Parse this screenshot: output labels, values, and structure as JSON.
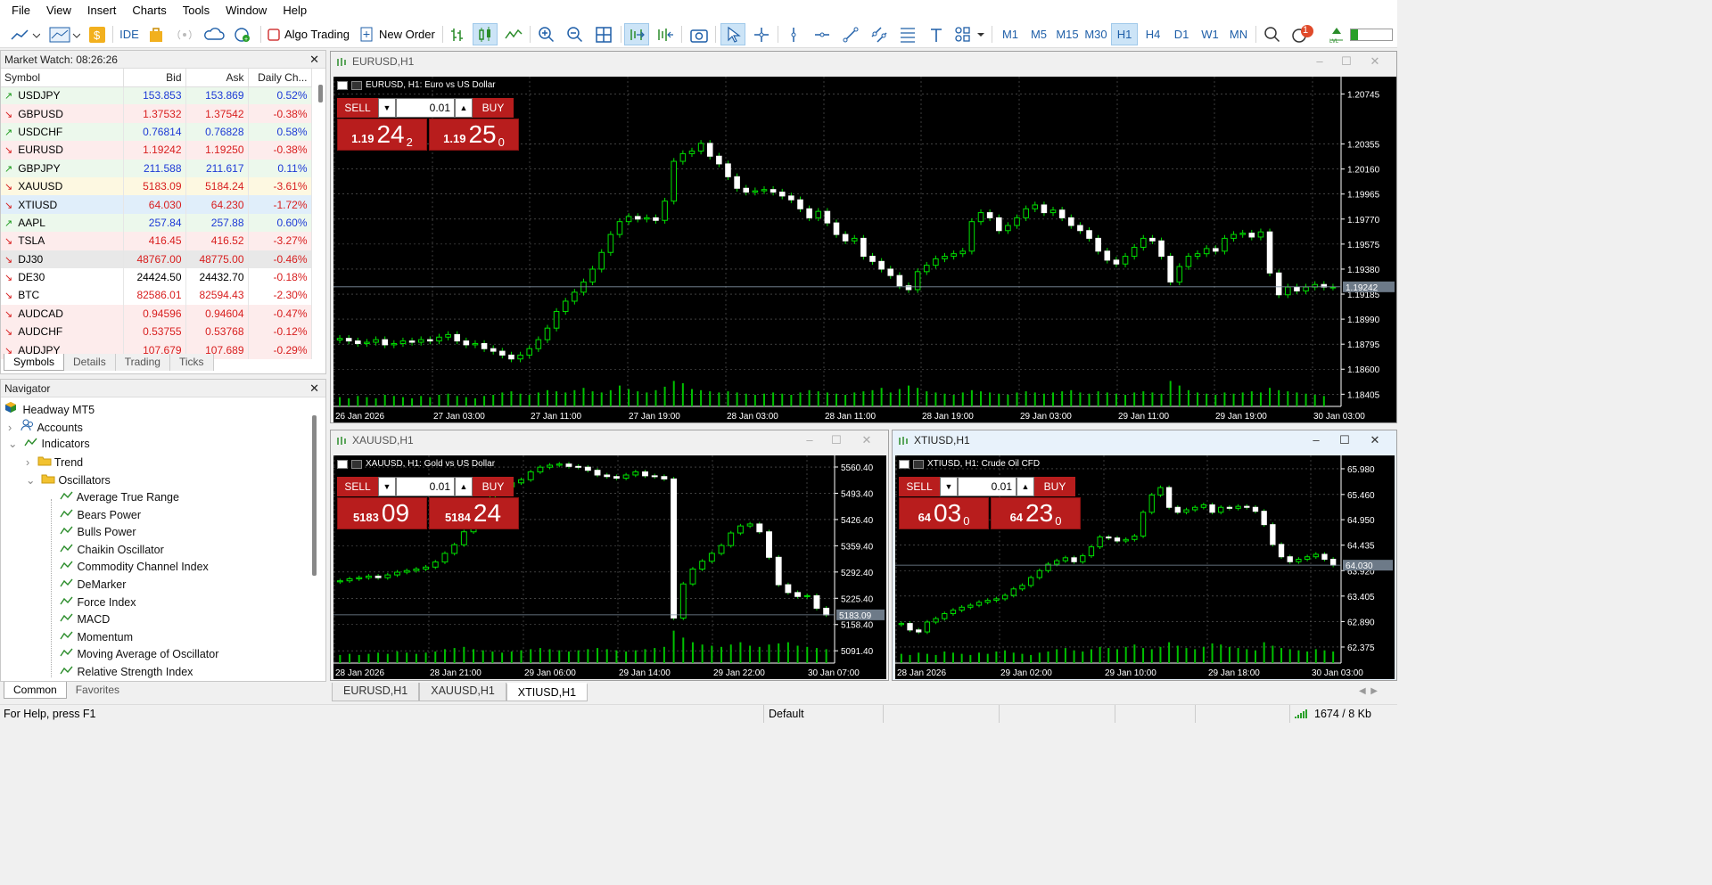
{
  "menu": [
    "File",
    "View",
    "Insert",
    "Charts",
    "Tools",
    "Window",
    "Help"
  ],
  "toolbar": {
    "ide_label": "IDE",
    "algo_label": "Algo Trading",
    "new_order_label": "New Order",
    "timeframes": [
      "M1",
      "M5",
      "M15",
      "M30",
      "H1",
      "H4",
      "D1",
      "W1",
      "MN"
    ],
    "active_timeframe": "H1",
    "notification_count": "1"
  },
  "market_watch": {
    "title": "Market Watch: 08:26:26",
    "headers": [
      "Symbol",
      "Bid",
      "Ask",
      "Daily Ch..."
    ],
    "rows": [
      {
        "symbol": "USDJPY",
        "bid": "153.853",
        "ask": "153.869",
        "change": "0.52%",
        "dir": "up"
      },
      {
        "symbol": "GBPUSD",
        "bid": "1.37532",
        "ask": "1.37542",
        "change": "-0.38%",
        "dir": "down"
      },
      {
        "symbol": "USDCHF",
        "bid": "0.76814",
        "ask": "0.76828",
        "change": "0.58%",
        "dir": "up"
      },
      {
        "symbol": "EURUSD",
        "bid": "1.19242",
        "ask": "1.19250",
        "change": "-0.38%",
        "dir": "down"
      },
      {
        "symbol": "GBPJPY",
        "bid": "211.588",
        "ask": "211.617",
        "change": "0.11%",
        "dir": "up"
      },
      {
        "symbol": "XAUUSD",
        "bid": "5183.09",
        "ask": "5184.24",
        "change": "-3.61%",
        "dir": "down"
      },
      {
        "symbol": "XTIUSD",
        "bid": "64.030",
        "ask": "64.230",
        "change": "-1.72%",
        "dir": "down"
      },
      {
        "symbol": "AAPL",
        "bid": "257.84",
        "ask": "257.88",
        "change": "0.60%",
        "dir": "up"
      },
      {
        "symbol": "TSLA",
        "bid": "416.45",
        "ask": "416.52",
        "change": "-3.27%",
        "dir": "down"
      },
      {
        "symbol": "DJ30",
        "bid": "48767.00",
        "ask": "48775.00",
        "change": "-0.46%",
        "dir": "down"
      },
      {
        "symbol": "DE30",
        "bid": "24424.50",
        "ask": "24432.70",
        "change": "-0.18%",
        "dir": "down"
      },
      {
        "symbol": "BTC",
        "bid": "82586.01",
        "ask": "82594.43",
        "change": "-2.30%",
        "dir": "down"
      },
      {
        "symbol": "AUDCAD",
        "bid": "0.94596",
        "ask": "0.94604",
        "change": "-0.47%",
        "dir": "down"
      },
      {
        "symbol": "AUDCHF",
        "bid": "0.53755",
        "ask": "0.53768",
        "change": "-0.12%",
        "dir": "down"
      },
      {
        "symbol": "AUDJPY",
        "bid": "107.679",
        "ask": "107.689",
        "change": "-0.29%",
        "dir": "down"
      }
    ],
    "tabs": [
      "Symbols",
      "Details",
      "Trading",
      "Ticks"
    ],
    "active_tab": "Symbols"
  },
  "navigator": {
    "title": "Navigator",
    "root": "Headway MT5",
    "accounts": "Accounts",
    "indicators": "Indicators",
    "trend": "Trend",
    "oscillators": "Oscillators",
    "items": [
      "Average True Range",
      "Bears Power",
      "Bulls Power",
      "Chaikin Oscillator",
      "Commodity Channel Index",
      "DeMarker",
      "Force Index",
      "MACD",
      "Momentum",
      "Moving Average of Oscillator",
      "Relative Strength Index"
    ],
    "tabs": [
      "Common",
      "Favorites"
    ],
    "active_tab": "Common"
  },
  "charts": [
    {
      "window_title": "EURUSD,H1",
      "title": "EURUSD, H1:  Euro vs US Dollar",
      "sell_label": "SELL",
      "buy_label": "BUY",
      "lot": "0.01",
      "sell_small": "1.19",
      "sell_big": "24",
      "sell_sup": "2",
      "buy_small": "1.19",
      "buy_big": "25",
      "buy_sup": "0",
      "price_label": "1.19242",
      "y_ticks": [
        "1.20745",
        "1.20355",
        "1.20160",
        "1.19965",
        "1.19770",
        "1.19575",
        "1.19380",
        "1.19185",
        "1.18990",
        "1.18795",
        "1.18600",
        "1.18405"
      ],
      "x_ticks": [
        "26 Jan 2026",
        "27 Jan 03:00",
        "27 Jan 11:00",
        "27 Jan 19:00",
        "28 Jan 03:00",
        "28 Jan 11:00",
        "28 Jan 19:00",
        "29 Jan 03:00",
        "29 Jan 11:00",
        "29 Jan 19:00",
        "30 Jan 03:00"
      ],
      "chart_data": {
        "type": "candlestick",
        "y_range": [
          1.1831,
          1.2088
        ],
        "closes": [
          1.1884,
          1.1882,
          1.188,
          1.1881,
          1.1883,
          1.1879,
          1.188,
          1.1882,
          1.1881,
          1.1883,
          1.1882,
          1.1885,
          1.1887,
          1.1882,
          1.1879,
          1.188,
          1.1876,
          1.1874,
          1.1871,
          1.1868,
          1.1871,
          1.1876,
          1.1883,
          1.1892,
          1.1905,
          1.1913,
          1.192,
          1.1928,
          1.1938,
          1.1951,
          1.1965,
          1.1975,
          1.1979,
          1.1977,
          1.1978,
          1.1976,
          1.1991,
          1.2022,
          1.2028,
          1.203,
          1.2036,
          1.2026,
          1.202,
          1.201,
          1.2001,
          1.1998,
          1.1999,
          1.2,
          1.1998,
          1.1995,
          1.1992,
          1.1985,
          1.1978,
          1.1983,
          1.1974,
          1.1965,
          1.196,
          1.1962,
          1.1948,
          1.1944,
          1.1938,
          1.1933,
          1.1925,
          1.1922,
          1.1936,
          1.1941,
          1.1946,
          1.1948,
          1.195,
          1.1952,
          1.1975,
          1.1982,
          1.1978,
          1.1968,
          1.1972,
          1.1978,
          1.1985,
          1.1988,
          1.1982,
          1.1984,
          1.1978,
          1.1972,
          1.1968,
          1.1962,
          1.1952,
          1.1945,
          1.1942,
          1.1948,
          1.1955,
          1.1962,
          1.196,
          1.1948,
          1.1928,
          1.194,
          1.1948,
          1.195,
          1.1954,
          1.1952,
          1.1962,
          1.1965,
          1.1966,
          1.1963,
          1.1967,
          1.1935,
          1.1918,
          1.1924,
          1.1921,
          1.1924,
          1.1926,
          1.1924,
          1.1924
        ],
        "volumes": [
          8,
          7,
          9,
          8,
          7,
          10,
          9,
          8,
          7,
          9,
          8,
          10,
          11,
          9,
          8,
          7,
          9,
          10,
          12,
          13,
          11,
          10,
          12,
          14,
          13,
          12,
          14,
          16,
          13,
          12,
          14,
          18,
          15,
          13,
          12,
          14,
          17,
          22,
          20,
          15,
          14,
          13,
          12,
          13,
          12,
          11,
          10,
          11,
          12,
          11,
          10,
          12,
          14,
          13,
          12,
          11,
          10,
          12,
          13,
          14,
          16,
          12,
          15,
          18,
          16,
          13,
          12,
          11,
          10,
          12,
          14,
          13,
          12,
          11,
          10,
          12,
          13,
          12,
          11,
          12,
          13,
          14,
          12,
          11,
          13,
          12,
          11,
          10,
          12,
          13,
          12,
          11,
          22,
          18,
          14,
          12,
          11,
          10,
          12,
          11,
          12,
          13,
          12,
          16,
          14,
          13,
          12,
          11,
          10,
          9
        ]
      }
    },
    {
      "window_title": "XAUUSD,H1",
      "title": "XAUUSD, H1:  Gold vs US Dollar",
      "sell_label": "SELL",
      "buy_label": "BUY",
      "lot": "0.01",
      "sell_small": "5183",
      "sell_big": "09",
      "sell_sup": "",
      "buy_small": "5184",
      "buy_big": "24",
      "buy_sup": "",
      "price_label": "5183.09",
      "y_ticks": [
        "5560.40",
        "5493.40",
        "5426.40",
        "5359.40",
        "5292.40",
        "5225.40",
        "5158.40",
        "5091.40"
      ],
      "x_ticks": [
        "28 Jan 2026",
        "28 Jan 21:00",
        "29 Jan 06:00",
        "29 Jan 14:00",
        "29 Jan 22:00",
        "30 Jan 07:00"
      ],
      "chart_data": {
        "type": "candlestick",
        "y_range": [
          5060,
          5590
        ],
        "closes": [
          5270,
          5275,
          5278,
          5282,
          5278,
          5285,
          5292,
          5296,
          5300,
          5305,
          5318,
          5340,
          5362,
          5395,
          5430,
          5470,
          5500,
          5510,
          5520,
          5528,
          5548,
          5560,
          5565,
          5568,
          5562,
          5560,
          5552,
          5540,
          5536,
          5532,
          5540,
          5548,
          5538,
          5536,
          5530,
          5175,
          5262,
          5300,
          5320,
          5340,
          5360,
          5392,
          5410,
          5415,
          5395,
          5330,
          5260,
          5240,
          5230,
          5232,
          5200,
          5183
        ],
        "volumes": [
          7,
          8,
          7,
          8,
          9,
          8,
          10,
          9,
          8,
          9,
          10,
          12,
          13,
          14,
          12,
          11,
          10,
          9,
          10,
          11,
          12,
          13,
          12,
          11,
          10,
          11,
          12,
          13,
          12,
          11,
          10,
          11,
          12,
          13,
          14,
          28,
          22,
          18,
          16,
          15,
          14,
          16,
          18,
          15,
          14,
          16,
          17,
          18,
          15,
          14,
          13,
          12
        ]
      }
    },
    {
      "window_title": "XTIUSD,H1",
      "title": "XTIUSD, H1:  Crude Oil CFD",
      "sell_label": "SELL",
      "buy_label": "BUY",
      "lot": "0.01",
      "sell_small": "64",
      "sell_big": "03",
      "sell_sup": "0",
      "buy_small": "64",
      "buy_big": "23",
      "buy_sup": "0",
      "price_label": "64.030",
      "y_ticks": [
        "65.980",
        "65.460",
        "64.950",
        "64.435",
        "63.920",
        "63.405",
        "62.890",
        "62.375"
      ],
      "x_ticks": [
        "28 Jan 2026",
        "29 Jan 02:00",
        "29 Jan 10:00",
        "29 Jan 18:00",
        "30 Jan 03:00"
      ],
      "chart_data": {
        "type": "candlestick",
        "y_range": [
          62.05,
          66.25
        ],
        "closes": [
          62.85,
          62.72,
          62.68,
          62.88,
          62.95,
          63.05,
          63.12,
          63.18,
          63.22,
          63.28,
          63.32,
          63.35,
          63.42,
          63.55,
          63.62,
          63.78,
          63.92,
          64.05,
          64.12,
          64.18,
          64.1,
          64.22,
          64.4,
          64.6,
          64.58,
          64.52,
          64.55,
          64.62,
          65.1,
          65.45,
          65.6,
          65.2,
          65.1,
          65.15,
          65.2,
          65.25,
          65.1,
          65.2,
          65.18,
          65.22,
          65.2,
          65.12,
          64.85,
          64.45,
          64.2,
          64.1,
          64.15,
          64.2,
          64.25,
          64.15,
          64.03
        ],
        "volumes": [
          8,
          7,
          9,
          8,
          7,
          10,
          9,
          8,
          7,
          9,
          8,
          10,
          11,
          9,
          8,
          7,
          9,
          10,
          12,
          13,
          11,
          10,
          12,
          14,
          13,
          12,
          14,
          16,
          13,
          12,
          14,
          18,
          15,
          13,
          12,
          14,
          17,
          16,
          14,
          13,
          12,
          11,
          18,
          15,
          13,
          12,
          11,
          10,
          12,
          11,
          10
        ]
      }
    }
  ],
  "bottom_tabs": [
    "EURUSD,H1",
    "XAUUSD,H1",
    "XTIUSD,H1"
  ],
  "active_bottom_tab": "XTIUSD,H1",
  "status": {
    "help": "For Help, press F1",
    "profile": "Default",
    "traffic": "1674 / 8 Kb"
  }
}
